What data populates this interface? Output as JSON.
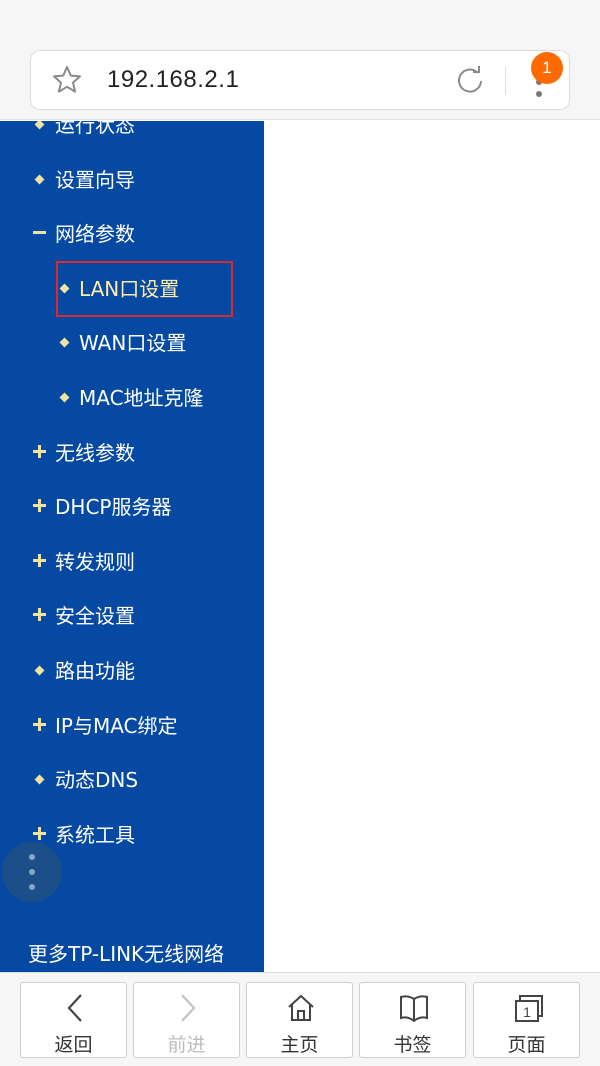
{
  "browser": {
    "url": "192.168.2.1",
    "badge_count": "1"
  },
  "sidebar": {
    "items": [
      {
        "label": "运行状态",
        "marker": "bullet"
      },
      {
        "label": "设置向导",
        "marker": "bullet"
      },
      {
        "label": "网络参数",
        "marker": "minus"
      },
      {
        "label": "LAN口设置",
        "marker": "bullet",
        "sub": true,
        "active": true
      },
      {
        "label": "WAN口设置",
        "marker": "bullet",
        "sub": true
      },
      {
        "label": "MAC地址克隆",
        "marker": "bullet",
        "sub": true
      },
      {
        "label": "无线参数",
        "marker": "plus"
      },
      {
        "label": "DHCP服务器",
        "marker": "plus"
      },
      {
        "label": "转发规则",
        "marker": "plus"
      },
      {
        "label": "安全设置",
        "marker": "plus"
      },
      {
        "label": "路由功能",
        "marker": "bullet"
      },
      {
        "label": "IP与MAC绑定",
        "marker": "plus"
      },
      {
        "label": "动态DNS",
        "marker": "bullet"
      },
      {
        "label": "系统工具",
        "marker": "plus"
      }
    ],
    "more_link": "更多TP-LINK无线网络"
  },
  "bottom_nav": {
    "back": "返回",
    "forward": "前进",
    "home": "主页",
    "bookmarks": "书签",
    "pages": "页面"
  },
  "colors": {
    "sidebar_bg": "#0649a3",
    "accent_badge": "#ff6a00",
    "highlight_border": "#d92b2b"
  }
}
